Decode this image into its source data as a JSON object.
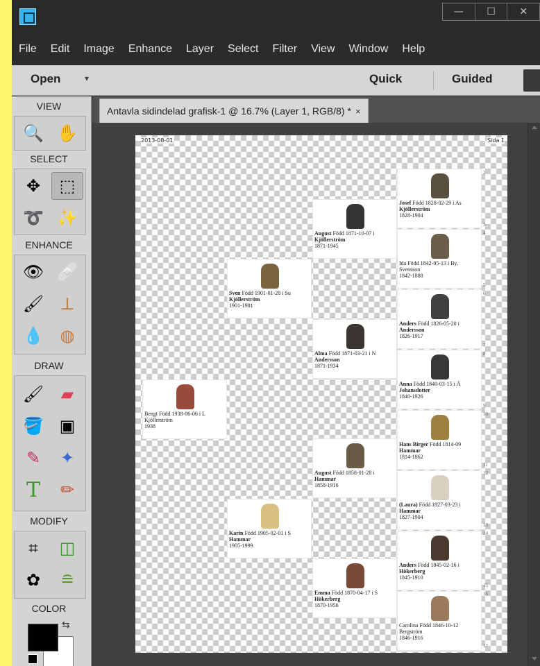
{
  "window": {
    "minimize": "—",
    "maximize": "☐",
    "close": "✕"
  },
  "menubar": [
    "File",
    "Edit",
    "Image",
    "Enhance",
    "Layer",
    "Select",
    "Filter",
    "View",
    "Window",
    "Help"
  ],
  "toolbar": {
    "open": "Open",
    "open_arrow": "▾",
    "quick": "Quick",
    "guided": "Guided"
  },
  "panel": {
    "sections": [
      "VIEW",
      "SELECT",
      "ENHANCE",
      "DRAW",
      "MODIFY",
      "COLOR"
    ],
    "tools": {
      "zoom": "🔍",
      "hand": "✋",
      "move": "✥",
      "marquee": "⬚",
      "lasso": "➰",
      "quick_select": "✨",
      "red_eye": "👁",
      "healing": "🩹",
      "smart_brush": "🖌",
      "stamp": "⊥",
      "blur": "💧",
      "sponge": "◍",
      "brush": "🖌",
      "eraser": "▰",
      "bucket": "🪣",
      "gradient": "▣",
      "eyedropper": "✎",
      "shape": "✦",
      "type": "T",
      "pencil": "✏",
      "crop": "⌗",
      "recompose": "◫",
      "cookie_cutter": "✿",
      "straighten": "≘"
    },
    "colors": {
      "foreground": "#000000",
      "background": "#ffffff",
      "swap": "⇆"
    }
  },
  "document": {
    "tab_title": "Antavla sidindelad grafisk-1 @ 16.7% (Layer 1, RGB/8) *",
    "tab_close": "×",
    "date": "2013-08-01",
    "page": "Sida 1"
  },
  "persons": [
    {
      "name": "Bengt",
      "born": " Född 1938-06-06 i L",
      "surname": "Kjöllerström",
      "years": "1938",
      "photo": "#9a4a3a",
      "bold": false
    },
    {
      "name": "Sven",
      "born": " Född 1901-01-28 i Su",
      "surname": "Kjöllerström",
      "years": "1901-1981",
      "photo": "#7a6440",
      "bold": true
    },
    {
      "name": "Karin",
      "born": " Född 1905-02-01 i S",
      "surname": "Hammar",
      "years": "1905-1999",
      "photo": "#d8c080",
      "bold": true
    },
    {
      "name": "August",
      "born": " Född 1871-10-07 i",
      "surname": "Kjöllerström",
      "years": "1871-1945",
      "photo": "#333333",
      "bold": true
    },
    {
      "name": "Alma",
      "born": " Född 1871-03-21 i N",
      "surname": "Andersson",
      "years": "1871-1934",
      "photo": "#3a3530",
      "bold": true
    },
    {
      "name": "August",
      "born": " Född 1858-01-28 i",
      "surname": "Hammar",
      "years": "1858-1916",
      "photo": "#6a5a48",
      "bold": true
    },
    {
      "name": "Emma",
      "born": " Född 1870-04-17 i S",
      "surname": "Hökerberg",
      "years": "1870-1956",
      "photo": "#7a4a38",
      "bold": true
    },
    {
      "name": "Josef",
      "born": " Född 1828-02-29 i As",
      "surname": "Kjöllerström",
      "years": "1828-1904",
      "photo": "#5a5040",
      "bold": true
    },
    {
      "name": "Ida",
      "born": " Född 1842-05-13 i By,",
      "surname": "Svensson",
      "years": "1842-1888",
      "photo": "#6a5e4a",
      "bold": false
    },
    {
      "name": "Anders",
      "born": " Född 1826-05-20 i",
      "surname": "Andersson",
      "years": "1826-1917",
      "photo": "#404040",
      "bold": true
    },
    {
      "name": "Anna",
      "born": " Född 1840-03-15 i Ä",
      "surname": "Johansdotter",
      "years": "1840-1926",
      "photo": "#383838",
      "bold": true
    },
    {
      "name": "Hans Birger",
      "born": " Född 1814-09",
      "surname": "Hammar",
      "years": "1814-1862",
      "photo": "#a08040",
      "bold": true
    },
    {
      "name": "(Laura)",
      "born": " Född 1827-03-23 i",
      "surname": "Hammar",
      "years": "1827-1904",
      "photo": "#d8d0c0",
      "bold": true
    },
    {
      "name": "Anders",
      "born": " Född 1845-02-16 i",
      "surname": "Hökerberg",
      "years": "1845-1910",
      "photo": "#4a3a30",
      "bold": true
    },
    {
      "name": "Carolina",
      "born": " Född 1846-10-12",
      "surname": "Bergström",
      "years": "1846-1916",
      "photo": "#9a7a5a",
      "bold": false
    }
  ],
  "page_markers": [
    "2",
    "3",
    "4",
    "5",
    "6",
    "7",
    "8",
    "9",
    "10",
    "11",
    "12",
    "13",
    "14",
    "15",
    "16",
    "17"
  ]
}
